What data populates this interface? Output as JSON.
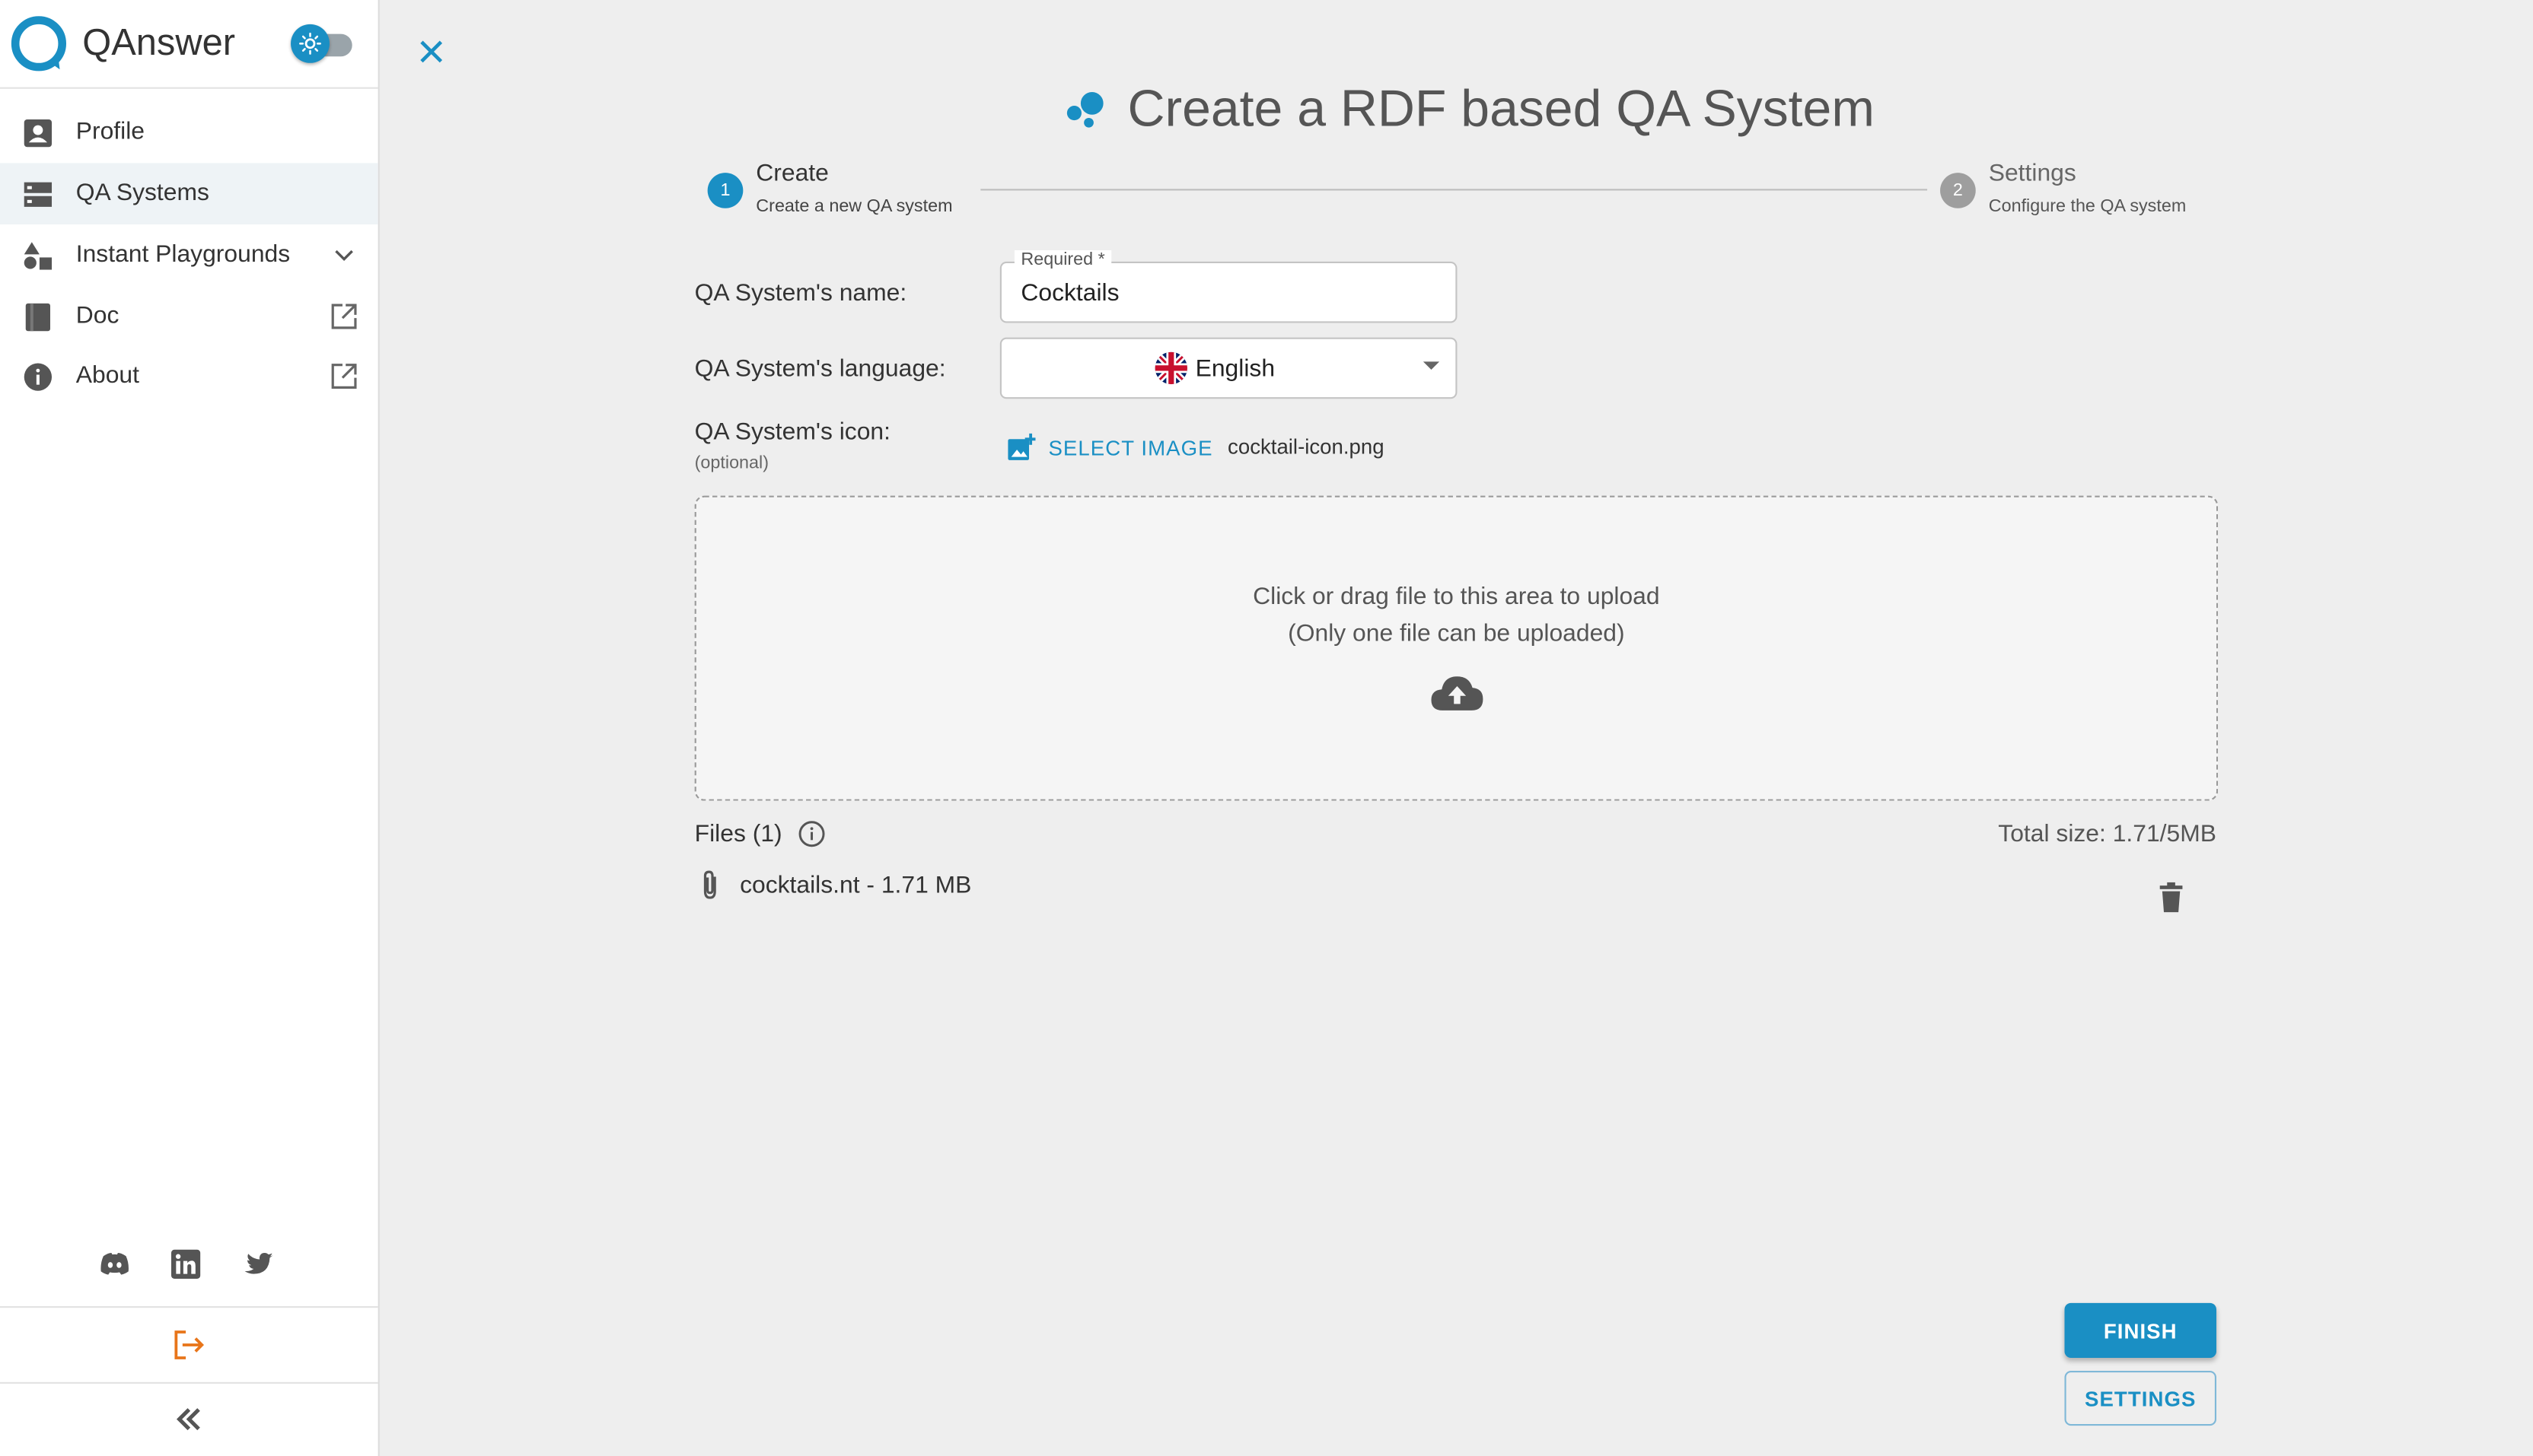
{
  "app": {
    "name": "QAnswer"
  },
  "sidebar": {
    "items": [
      {
        "label": "Profile",
        "icon": "profile-icon"
      },
      {
        "label": "QA Systems",
        "icon": "qa-systems-icon",
        "active": true
      },
      {
        "label": "Instant Playgrounds",
        "icon": "shapes-icon",
        "trailing": "chevron-down-icon"
      },
      {
        "label": "Doc",
        "icon": "book-icon",
        "trailing": "external-link-icon"
      },
      {
        "label": "About",
        "icon": "info-icon",
        "trailing": "external-link-icon"
      }
    ],
    "social": [
      "discord-icon",
      "linkedin-icon",
      "twitter-icon"
    ]
  },
  "page": {
    "title": "Create a RDF based QA System"
  },
  "stepper": {
    "steps": [
      {
        "number": "1",
        "title": "Create",
        "subtitle": "Create a new QA system",
        "active": true
      },
      {
        "number": "2",
        "title": "Settings",
        "subtitle": "Configure the QA system",
        "active": false
      }
    ]
  },
  "form": {
    "name_label": "QA System's name:",
    "name_field_label": "Required *",
    "name_value": "Cocktails",
    "language_label": "QA System's language:",
    "language_value": "English",
    "icon_label": "QA System's icon:",
    "icon_sublabel": "(optional)",
    "select_image_label": "SELECT IMAGE",
    "icon_file": "cocktail-icon.png"
  },
  "dropzone": {
    "line1": "Click or drag file to this area to upload",
    "line2": "(Only one file can be uploaded)"
  },
  "files": {
    "label": "Files (1)",
    "total_size": "Total size: 1.71/5MB",
    "items": [
      {
        "text": "cocktails.nt - 1.71 MB"
      }
    ]
  },
  "actions": {
    "finish": "FINISH",
    "settings": "SETTINGS"
  },
  "colors": {
    "accent": "#1a8fc4",
    "logout": "#e8751a",
    "background": "#eeeeee"
  }
}
